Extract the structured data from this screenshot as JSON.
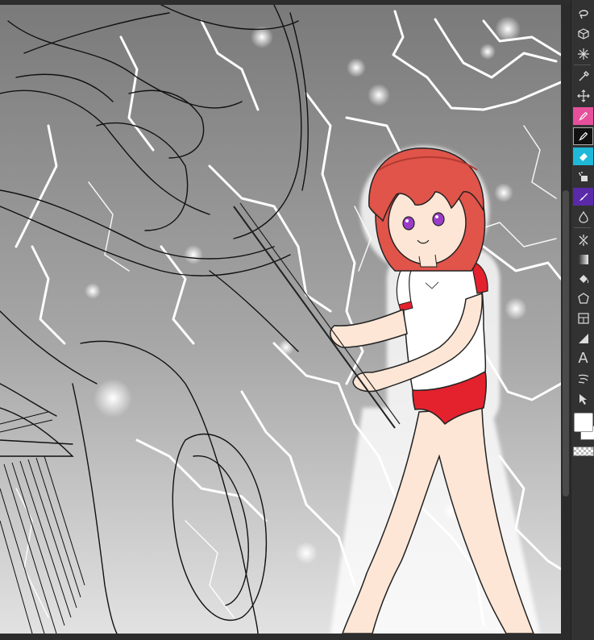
{
  "app": {
    "name": ""
  },
  "canvas": {
    "description_only": false,
    "colors": {
      "background_top": "#7f7f7f",
      "background_bottom": "#d8d8d8",
      "lightning": "#ffffff",
      "hair": "#e0544a",
      "skin": "#fde6d6",
      "shirt": "#ffffff",
      "shorts": "#e3222e",
      "eyes": "#9a3cc8",
      "sketch": "#111111"
    }
  },
  "toolbox": {
    "tools": [
      {
        "icon": "lasso-icon"
      },
      {
        "icon": "cube-icon"
      },
      {
        "icon": "sparkle-icon"
      },
      {
        "icon": "eyedropper-icon"
      },
      {
        "icon": "move-arrows-icon"
      },
      {
        "icon": "pen-pink-icon"
      },
      {
        "icon": "pen-black-icon"
      },
      {
        "icon": "eraser-cyan-icon"
      },
      {
        "icon": "airbrush-icon"
      },
      {
        "icon": "brush-purple-icon"
      },
      {
        "icon": "blend-drop-icon"
      },
      {
        "icon": "sparkle-decoration-icon"
      },
      {
        "icon": "gradient-icon"
      },
      {
        "icon": "fill-bucket-icon"
      },
      {
        "icon": "shape-polygon-icon"
      },
      {
        "icon": "frame-icon"
      },
      {
        "icon": "ruler-icon"
      },
      {
        "icon": "text-icon"
      },
      {
        "icon": "balloon-icon"
      },
      {
        "icon": "object-select-icon"
      }
    ],
    "text_tool_label": "A",
    "main_color": "#ffffff",
    "sub_color": "#ffffff"
  }
}
